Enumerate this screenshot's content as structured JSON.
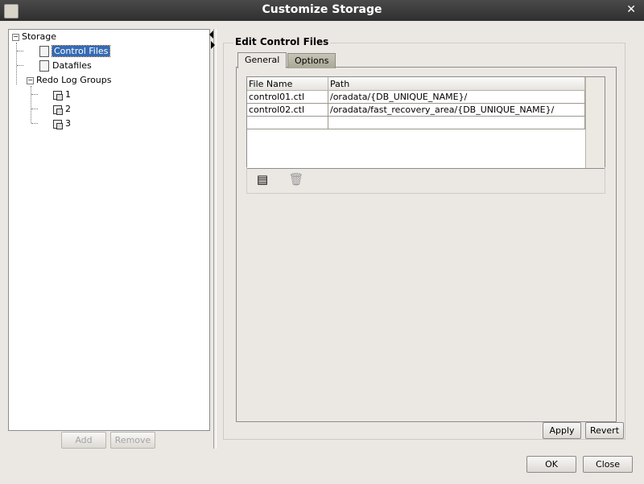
{
  "window": {
    "title": "Customize Storage"
  },
  "tree": {
    "root": "Storage",
    "items": [
      {
        "label": "Control Files",
        "selected": true
      },
      {
        "label": "Datafiles"
      },
      {
        "label": "Redo Log Groups"
      },
      {
        "label": "1"
      },
      {
        "label": "2"
      },
      {
        "label": "3"
      }
    ]
  },
  "left_buttons": {
    "add": "Add",
    "remove": "Remove"
  },
  "editor": {
    "title": "Edit Control Files",
    "tabs": [
      {
        "label": "General",
        "active": true
      },
      {
        "label": "Options"
      }
    ],
    "table": {
      "headers": [
        "File Name",
        "Path"
      ],
      "rows": [
        [
          "control01.ctl",
          "/oradata/{DB_UNIQUE_NAME}/"
        ],
        [
          "control02.ctl",
          "/oradata/fast_recovery_area/{DB_UNIQUE_NAME}/"
        ]
      ]
    },
    "icons": {
      "add_row": "add-row-icon",
      "delete_row": "trash-icon"
    }
  },
  "editor_buttons": {
    "apply": "Apply",
    "revert": "Revert"
  },
  "dialog_buttons": {
    "ok": "OK",
    "close": "Close"
  }
}
